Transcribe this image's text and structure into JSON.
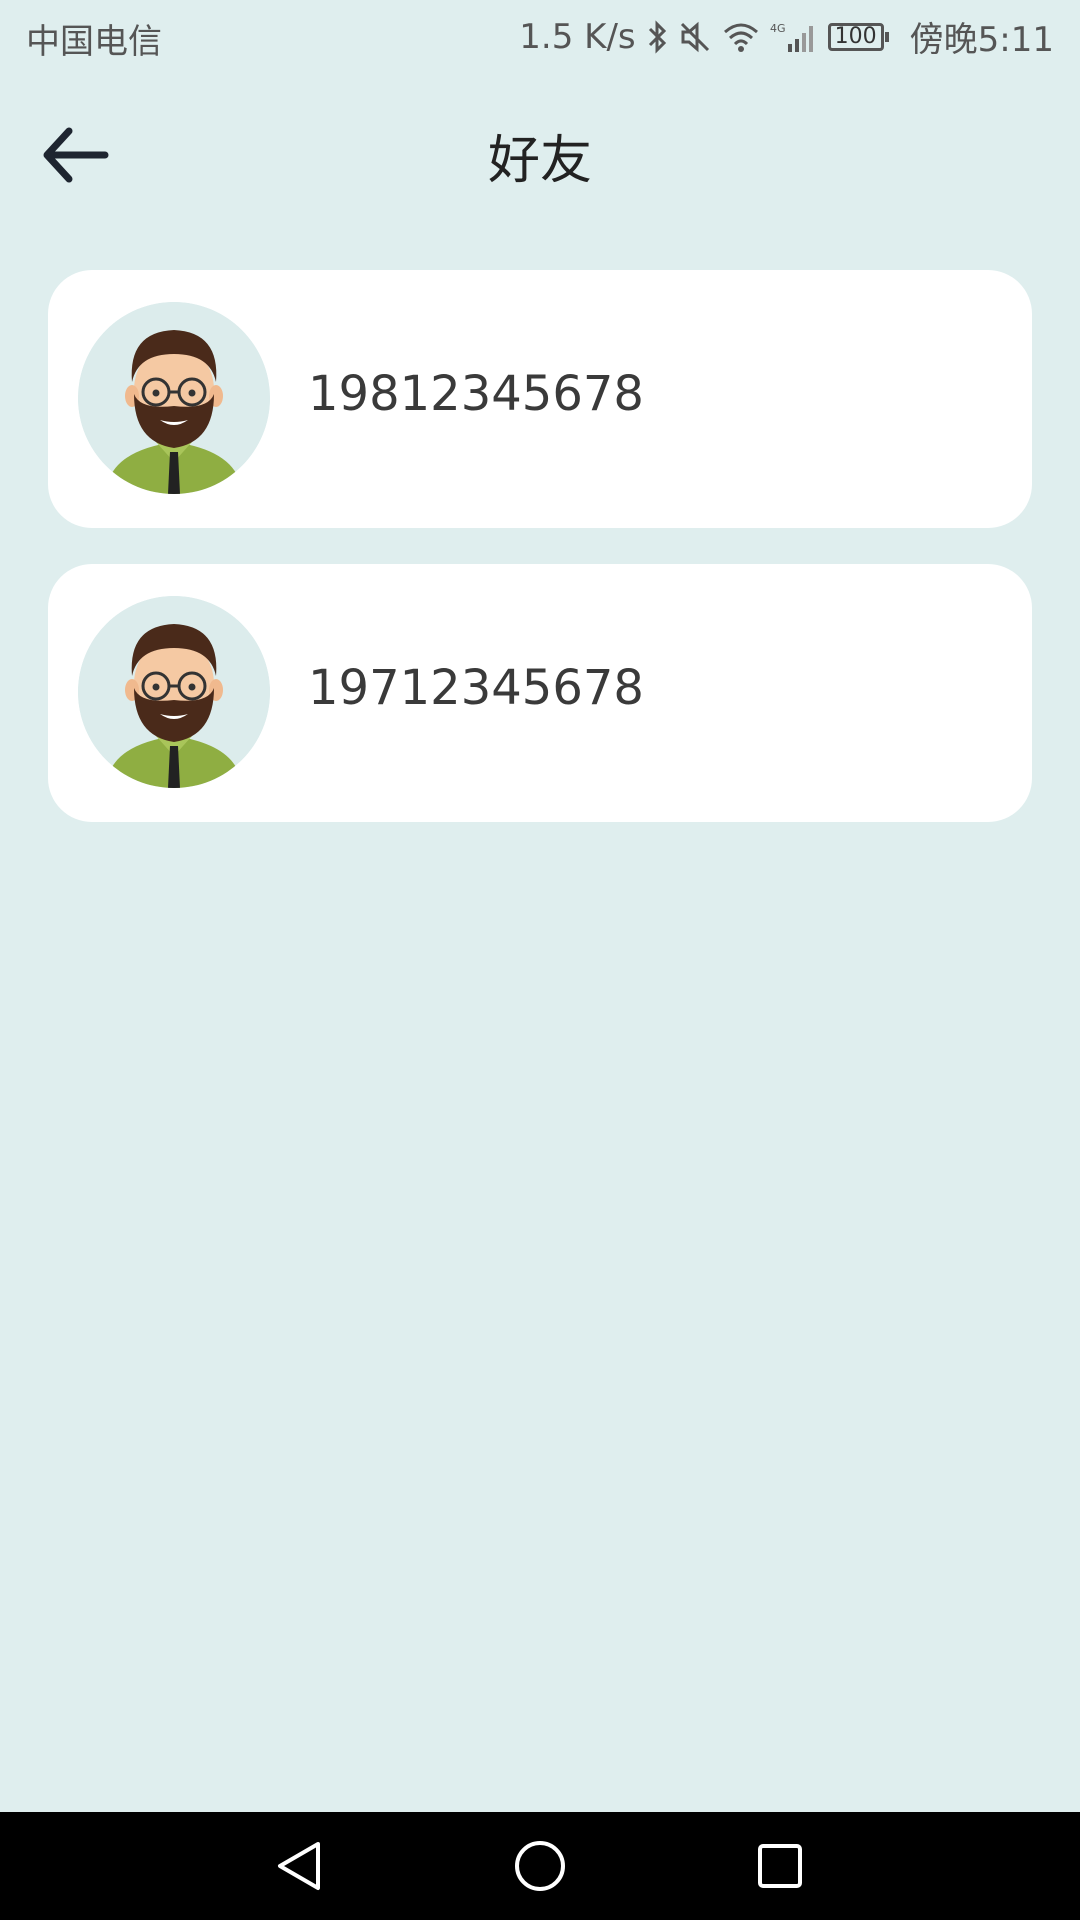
{
  "status_bar": {
    "carrier": "中国电信",
    "network_speed": "1.5 K/s",
    "network_type": "4G",
    "battery": "100",
    "time": "傍晚5:11"
  },
  "header": {
    "title": "好友",
    "back_icon": "arrow-left-icon"
  },
  "friends": [
    {
      "name": "19812345678",
      "avatar": "bearded-man-avatar"
    },
    {
      "name": "19712345678",
      "avatar": "bearded-man-avatar"
    }
  ],
  "nav": {
    "back": "triangle-back-icon",
    "home": "circle-home-icon",
    "recent": "square-recent-icon"
  },
  "colors": {
    "background": "#dfeeee",
    "card": "#ffffff",
    "nav_bar": "#000000",
    "shirt": "#8fae42",
    "hair": "#4a2a1a",
    "skin": "#f5c9a3"
  }
}
